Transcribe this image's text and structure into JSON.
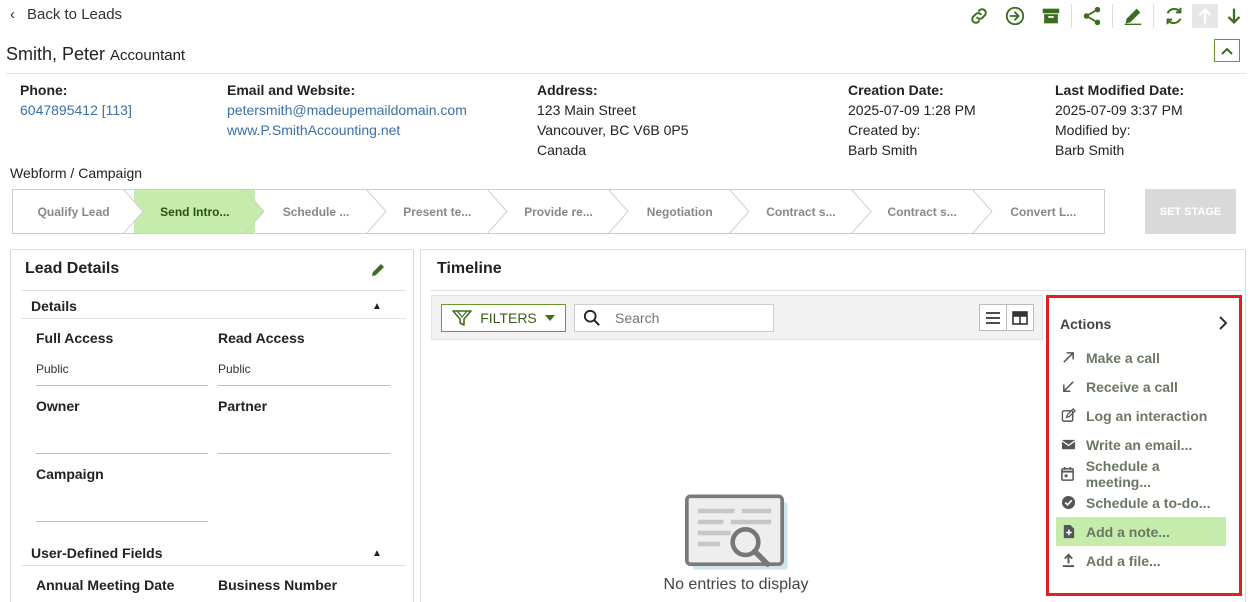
{
  "header": {
    "back_label": "Back to Leads",
    "name": "Smith, Peter",
    "job_title": "Accountant"
  },
  "toolbar_icons": [
    "link-icon",
    "convert-arrow-icon",
    "archive-icon",
    "share-icon",
    "edit-pencil-icon",
    "refresh-icon",
    "arrow-up-icon",
    "arrow-down-icon"
  ],
  "info": {
    "phone": {
      "label": "Phone:",
      "value": "6047895412 [113]"
    },
    "email_web": {
      "label": "Email and Website:",
      "email": "petersmith@madeupemaildomain.com",
      "website": "www.P.SmithAccounting.net"
    },
    "address": {
      "label": "Address:",
      "line1": "123 Main Street",
      "line2": "Vancouver, BC V6B 0P5",
      "line3": "Canada"
    },
    "creation": {
      "label": "Creation Date:",
      "date": "2025-07-09 1:28 PM",
      "by_label": "Created by:",
      "by": "Barb Smith"
    },
    "modified": {
      "label": "Last Modified Date:",
      "date": "2025-07-09 3:37 PM",
      "by_label": "Modified by:",
      "by": "Barb Smith"
    }
  },
  "crumb": "Webform / Campaign",
  "stages": [
    {
      "label": "Qualify Lead",
      "active": false
    },
    {
      "label": "Send Intro...",
      "active": true
    },
    {
      "label": "Schedule ...",
      "active": false
    },
    {
      "label": "Present te...",
      "active": false
    },
    {
      "label": "Provide re...",
      "active": false
    },
    {
      "label": "Negotiation",
      "active": false
    },
    {
      "label": "Contract s...",
      "active": false
    },
    {
      "label": "Contract s...",
      "active": false
    },
    {
      "label": "Convert L...",
      "active": false
    }
  ],
  "set_stage_label": "SET STAGE",
  "lead_details": {
    "title": "Lead Details",
    "details_section": "Details",
    "full_access_label": "Full Access",
    "full_access_value": "Public",
    "read_access_label": "Read Access",
    "read_access_value": "Public",
    "owner_label": "Owner",
    "partner_label": "Partner",
    "campaign_label": "Campaign",
    "udf_section": "User-Defined Fields",
    "annual_meeting_label": "Annual Meeting Date",
    "business_number_label": "Business Number"
  },
  "timeline": {
    "title": "Timeline",
    "filters_label": "FILTERS",
    "search_placeholder": "Search",
    "empty_text": "No entries to display"
  },
  "actions": {
    "title": "Actions",
    "items": [
      {
        "label": "Make a call",
        "icon": "outgoing-call-icon",
        "selected": false
      },
      {
        "label": "Receive a call",
        "icon": "incoming-call-icon",
        "selected": false
      },
      {
        "label": "Log an interaction",
        "icon": "log-edit-icon",
        "selected": false
      },
      {
        "label": "Write an email...",
        "icon": "envelope-icon",
        "selected": false
      },
      {
        "label": "Schedule a meeting...",
        "icon": "calendar-icon",
        "selected": false
      },
      {
        "label": "Schedule a to-do...",
        "icon": "check-circle-icon",
        "selected": false
      },
      {
        "label": "Add a note...",
        "icon": "note-add-icon",
        "selected": true
      },
      {
        "label": "Add a file...",
        "icon": "upload-icon",
        "selected": false
      }
    ]
  },
  "colors": {
    "brand_green": "#3c6e1e",
    "active_stage": "#c5ecaa",
    "link_blue": "#3a6fa8",
    "highlight_red": "#e02020"
  }
}
